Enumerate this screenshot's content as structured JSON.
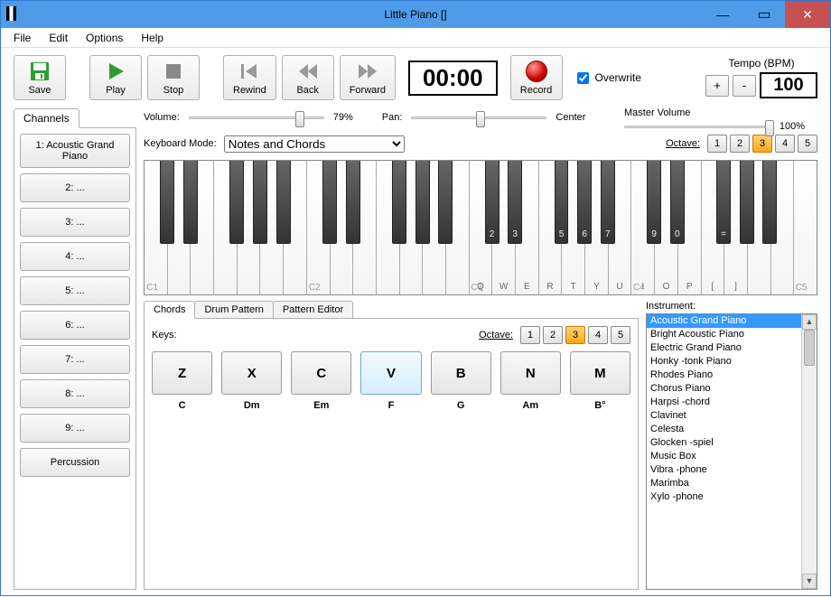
{
  "window": {
    "title": "Little Piano []"
  },
  "menu": {
    "file": "File",
    "edit": "Edit",
    "options": "Options",
    "help": "Help"
  },
  "toolbar": {
    "save": "Save",
    "play": "Play",
    "stop": "Stop",
    "rewind": "Rewind",
    "back": "Back",
    "forward": "Forward",
    "timecode": "00:00",
    "record": "Record",
    "overwrite_label": "Overwrite",
    "overwrite_checked": true,
    "tempo_label": "Tempo (BPM)",
    "tempo_value": "100"
  },
  "sliders": {
    "volume_label": "Volume:",
    "volume_text": "79%",
    "volume_pos": 0.79,
    "pan_label": "Pan:",
    "pan_text": "Center",
    "pan_pos": 0.5,
    "master_label": "Master Volume",
    "master_text": "100%",
    "master_pos": 1.0
  },
  "channels": {
    "tab": "Channels",
    "items": [
      "1: Acoustic Grand Piano",
      "2: ...",
      "3: ...",
      "4: ...",
      "5: ...",
      "6: ...",
      "7: ...",
      "8: ...",
      "9: ...",
      "Percussion"
    ]
  },
  "keyboard": {
    "mode_label": "Keyboard Mode:",
    "mode_value": "Notes and Chords",
    "octave_label": "Octave:",
    "octave_sel": 3,
    "white_labels": [
      "Q",
      "W",
      "E",
      "R",
      "T",
      "Y",
      "U",
      "I",
      "O",
      "P",
      "[",
      "]"
    ],
    "black_labels": [
      "2",
      "3",
      "5",
      "6",
      "7",
      "9",
      "0",
      "="
    ],
    "c_labels": [
      "C1",
      "C2",
      "C3",
      "C4",
      "C5"
    ]
  },
  "chords": {
    "tabs": [
      "Chords",
      "Drum Pattern",
      "Pattern Editor"
    ],
    "keys_label": "Keys:",
    "octave_label": "Octave:",
    "octave_sel": 3,
    "pads": [
      {
        "key": "Z",
        "chord": "C"
      },
      {
        "key": "X",
        "chord": "Dm"
      },
      {
        "key": "C",
        "chord": "Em"
      },
      {
        "key": "V",
        "chord": "F",
        "hl": true
      },
      {
        "key": "B",
        "chord": "G"
      },
      {
        "key": "N",
        "chord": "Am"
      },
      {
        "key": "M",
        "chord": "B°"
      }
    ]
  },
  "instruments": {
    "label": "Instrument:",
    "items": [
      "Acoustic Grand Piano",
      "Bright Acoustic Piano",
      "Electric Grand Piano",
      "Honky -tonk Piano",
      "Rhodes Piano",
      "Chorus Piano",
      "Harpsi -chord",
      "Clavinet",
      "Celesta",
      "Glocken -spiel",
      "Music Box",
      "Vibra -phone",
      "Marimba",
      "Xylo -phone"
    ],
    "selected": 0
  }
}
